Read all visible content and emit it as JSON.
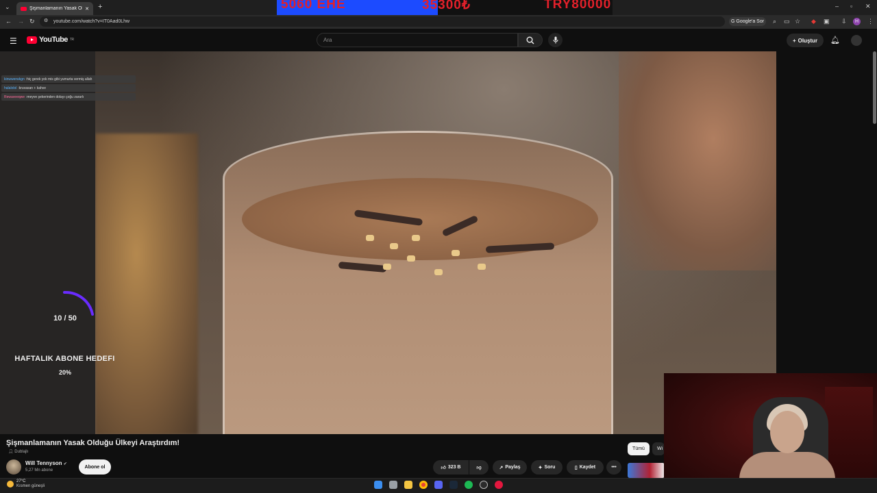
{
  "browser": {
    "tab_title": "Şişmanlamanın Yasak Olduğu Ü",
    "url": "youtube.com/watch?v=IT0Aad0Lhw",
    "google_sor": "Google'a Sor",
    "profile_initial": "H"
  },
  "ticker": [
    "5060 EHE",
    "35300₺",
    "TRY80000"
  ],
  "youtube": {
    "logo_text": "YouTube",
    "region": "TR",
    "search_placeholder": "Ara",
    "create_label": "Oluştur"
  },
  "chat": [
    {
      "user": "kinwwerwkgn",
      "text": "hiç gerek yok mis gibi yumurta vermiş allah"
    },
    {
      "user": "halalolol",
      "text": "kruvasan + kahve"
    },
    {
      "user": "Rewaveeqwe",
      "text": "meyve şekerinden dolayı çoğu zararlı"
    }
  ],
  "goal": {
    "current": "10 / 50",
    "title": "HAFTALIK ABONE HEDEFI",
    "percent": "20%",
    "progress": 0.2
  },
  "video": {
    "title": "Şişmanlamanın Yasak Olduğu Ülkeyi Araştırdım!",
    "dub_label": "Dublajlı",
    "channel": "Will Tennyson",
    "subscribers": "5,27 Mn abone",
    "subscribe_label": "Abone ol",
    "likes": "323 B",
    "share_label": "Paylaş",
    "ask_label": "Soru",
    "save_label": "Kaydet"
  },
  "sidebar_chips": {
    "all": "Tümü",
    "next": "Wi"
  },
  "taskbar": {
    "temp": "27°C",
    "condition": "Kısmen güneşli"
  },
  "colors": {
    "accent_red": "#ff0033",
    "ticker_blue": "#1c4bff",
    "goal_arc": "#6a2cff"
  }
}
